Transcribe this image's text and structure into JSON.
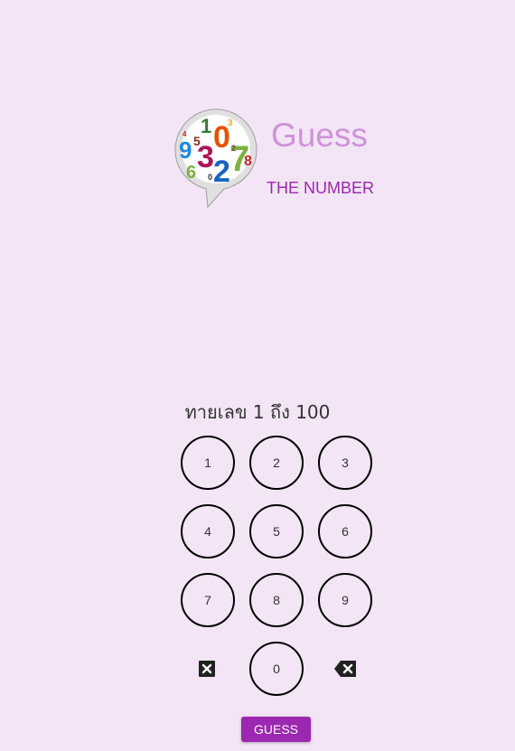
{
  "header": {
    "title": "Guess",
    "subtitle": "THE NUMBER",
    "logo_icon": "numbers-speech-bubble-icon"
  },
  "prompt": "ทายเลข 1 ถึง 100",
  "keypad": {
    "keys": [
      "1",
      "2",
      "3",
      "4",
      "5",
      "6",
      "7",
      "8",
      "9",
      "0"
    ],
    "clear_icon": "clear-box-icon",
    "backspace_icon": "backspace-icon"
  },
  "guess_button": {
    "label": "GUESS"
  },
  "colors": {
    "background": "#f3e5f5",
    "title": "#ce93d8",
    "subtitle": "#9c27b0",
    "button": "#9c27b0"
  }
}
